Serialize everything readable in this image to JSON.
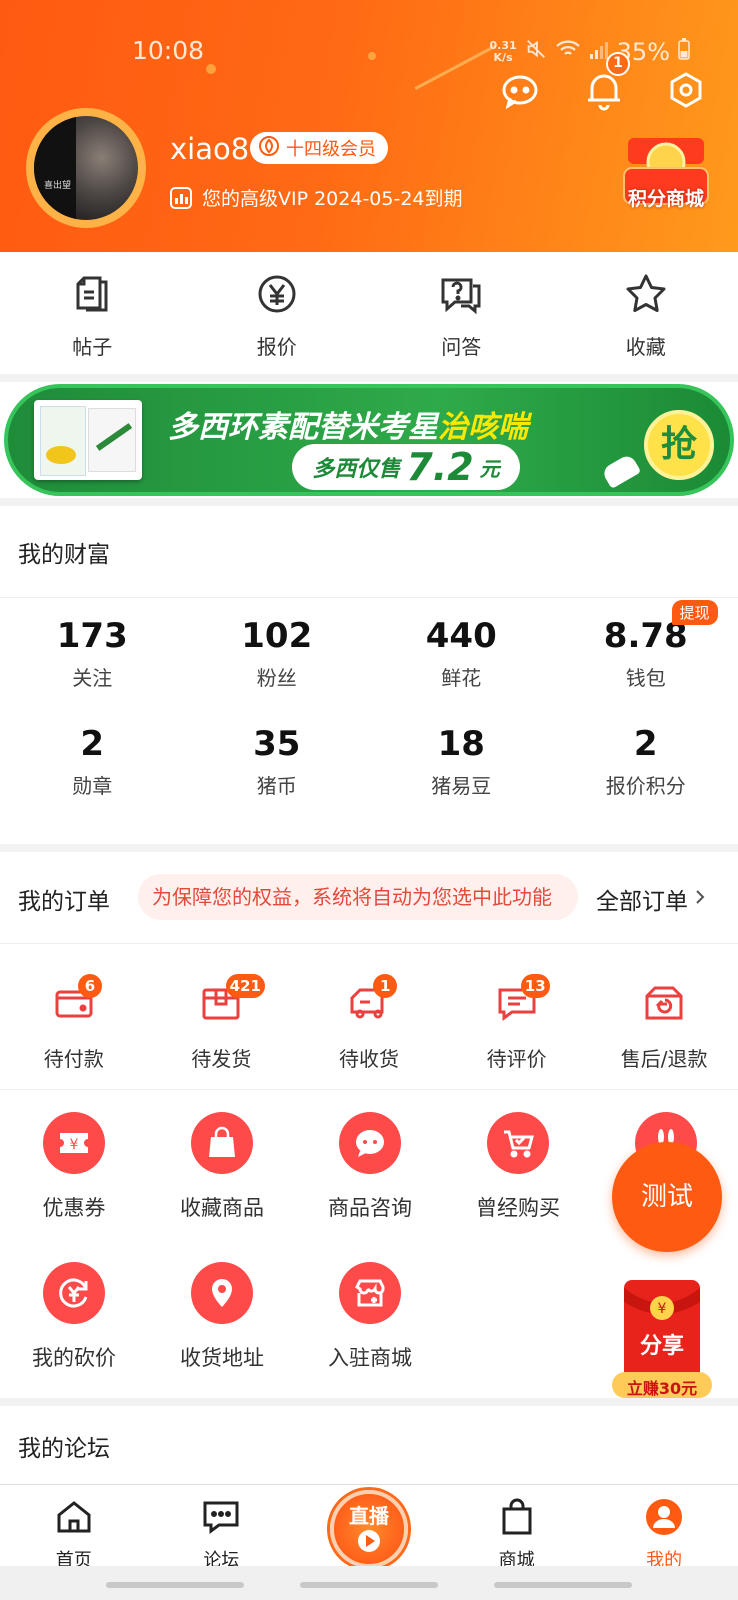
{
  "status_bar": {
    "time": "10:08",
    "net_speed_value": "0.31",
    "net_speed_unit": "K/s",
    "battery": "35%"
  },
  "header": {
    "notification_count": "1",
    "username": "xiao8",
    "member_level": "十四级会员",
    "vip_text": "您的高级VIP 2024-05-24到期",
    "mall_label": "积分商城",
    "avatar_text": "喜出望"
  },
  "quick_links": [
    {
      "label": "帖子",
      "icon": "document-icon"
    },
    {
      "label": "报价",
      "icon": "yen-icon"
    },
    {
      "label": "问答",
      "icon": "question-icon"
    },
    {
      "label": "收藏",
      "icon": "star-icon"
    }
  ],
  "banner": {
    "headline": "多西环素配替米考星",
    "headline_highlight": "治咳喘",
    "price_prefix": "多西仅售",
    "price": "7.2",
    "price_unit": "元",
    "grab": "抢"
  },
  "wealth": {
    "title": "我的财富",
    "withdraw": "提现",
    "items": [
      {
        "value": "173",
        "label": "关注"
      },
      {
        "value": "102",
        "label": "粉丝"
      },
      {
        "value": "440",
        "label": "鲜花"
      },
      {
        "value": "8.78",
        "label": "钱包"
      },
      {
        "value": "2",
        "label": "勋章"
      },
      {
        "value": "35",
        "label": "猪币"
      },
      {
        "value": "18",
        "label": "猪易豆"
      },
      {
        "value": "2",
        "label": "报价积分"
      }
    ]
  },
  "orders": {
    "title": "我的订单",
    "notice": "为保障您的权益，系统将自动为您选中此功能",
    "all_orders": "全部订单",
    "items": [
      {
        "label": "待付款",
        "count": "6"
      },
      {
        "label": "待发货",
        "count": "421"
      },
      {
        "label": "待收货",
        "count": "1"
      },
      {
        "label": "待评价",
        "count": "13"
      },
      {
        "label": "售后/退款",
        "count": ""
      }
    ]
  },
  "services": [
    {
      "label": "优惠券",
      "icon": "coupon-icon"
    },
    {
      "label": "收藏商品",
      "icon": "bag-icon"
    },
    {
      "label": "商品咨询",
      "icon": "chat-icon"
    },
    {
      "label": "曾经购买",
      "icon": "cart-icon"
    },
    {
      "label": "",
      "icon": "rabbit-icon"
    },
    {
      "label": "我的砍价",
      "icon": "bargain-icon"
    },
    {
      "label": "收货地址",
      "icon": "location-icon"
    },
    {
      "label": "入驻商城",
      "icon": "store-icon"
    }
  ],
  "floating": {
    "test": "测试",
    "share": "分享",
    "earn": "立赚30元"
  },
  "forum": {
    "title": "我的论坛"
  },
  "tabbar": [
    {
      "label": "首页",
      "icon": "home-icon"
    },
    {
      "label": "论坛",
      "icon": "forum-icon"
    },
    {
      "label": "直播",
      "icon": "live-icon"
    },
    {
      "label": "商城",
      "icon": "shopping-bag-icon"
    },
    {
      "label": "我的",
      "icon": "profile-icon"
    }
  ],
  "colors": {
    "brand": "#ff5a12",
    "badge": "#ff5a12",
    "service": "#ff4a4a",
    "banner_green": "#2faa4a"
  }
}
